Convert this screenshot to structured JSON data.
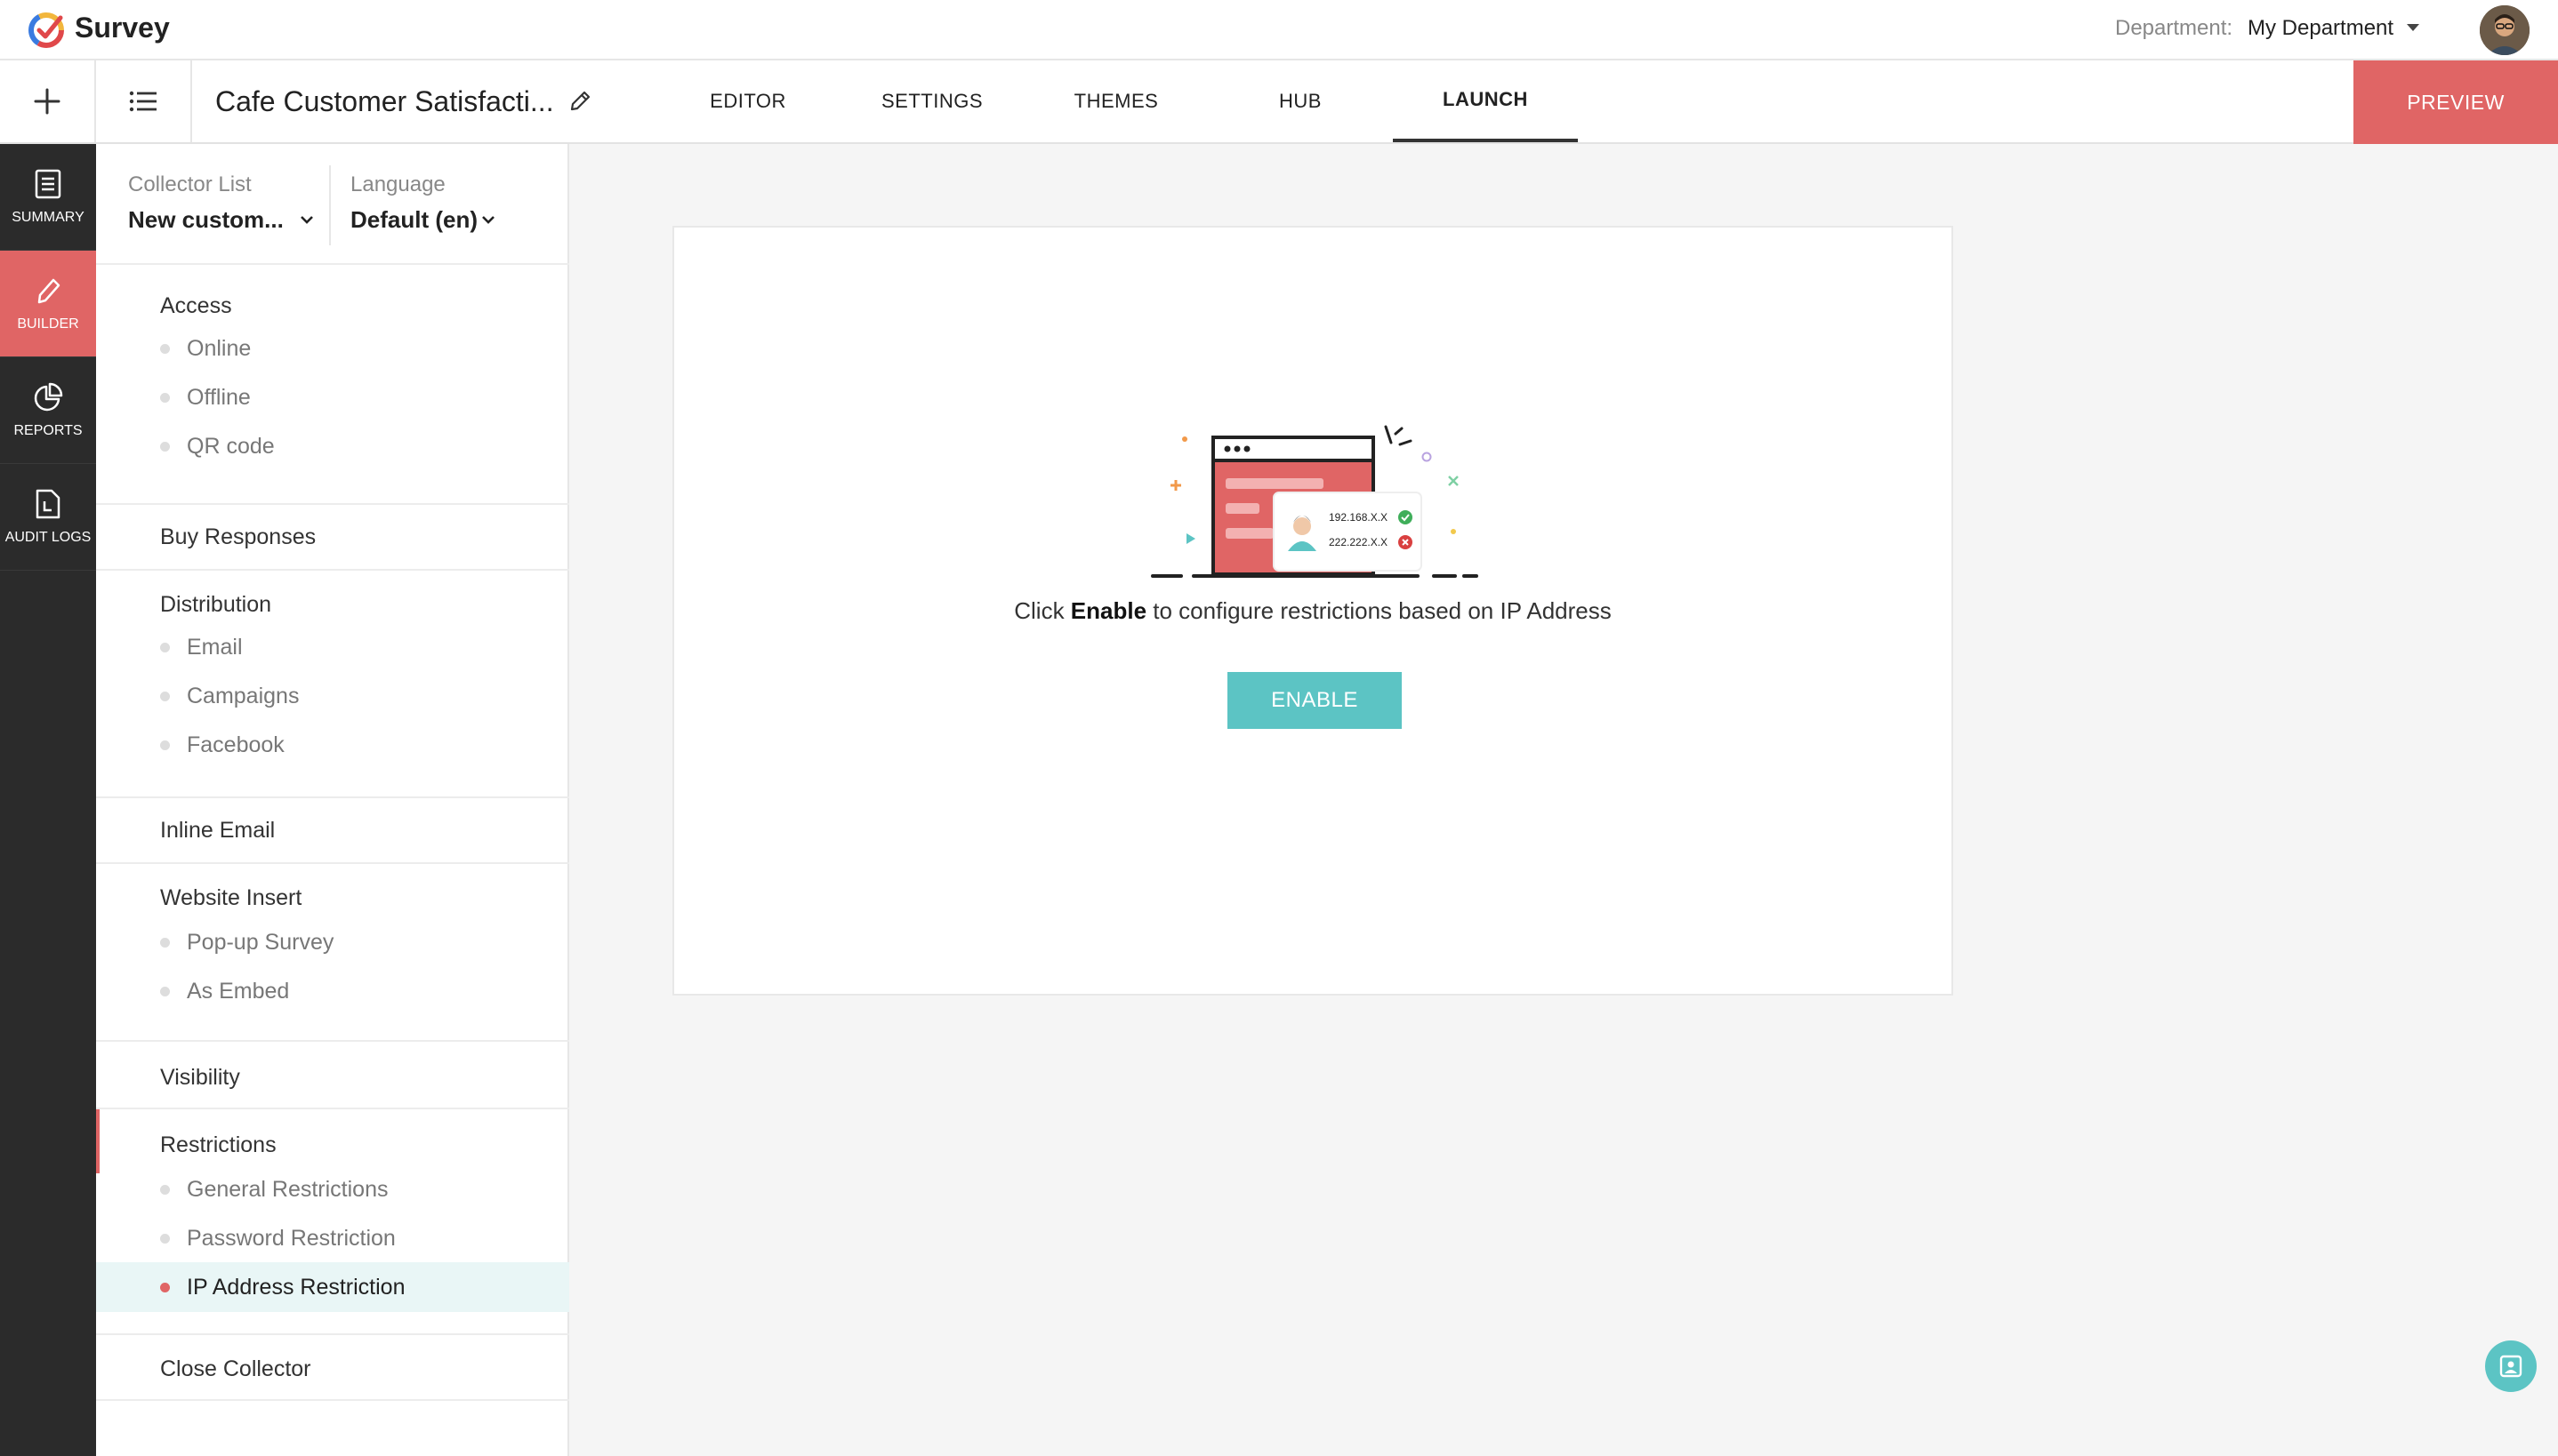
{
  "app": {
    "name": "Survey"
  },
  "header": {
    "department_label": "Department:",
    "department_value": "My Department"
  },
  "toolbar": {
    "survey_title": "Cafe Customer Satisfacti...",
    "tabs": [
      {
        "label": "EDITOR"
      },
      {
        "label": "SETTINGS"
      },
      {
        "label": "THEMES"
      },
      {
        "label": "HUB"
      },
      {
        "label": "LAUNCH",
        "active": true
      }
    ],
    "preview_label": "PREVIEW"
  },
  "rail": {
    "items": [
      {
        "label": "SUMMARY",
        "icon": "document-icon"
      },
      {
        "label": "BUILDER",
        "icon": "pencil-icon",
        "active": true
      },
      {
        "label": "REPORTS",
        "icon": "pie-chart-icon"
      },
      {
        "label": "AUDIT LOGS",
        "icon": "log-file-icon"
      }
    ]
  },
  "collector": {
    "list_label": "Collector List",
    "list_value": "New custom...",
    "language_label": "Language",
    "language_value": "Default (en)"
  },
  "nav": {
    "access": {
      "title": "Access",
      "items": [
        "Online",
        "Offline",
        "QR code"
      ]
    },
    "buy_responses": {
      "title": "Buy Responses"
    },
    "distribution": {
      "title": "Distribution",
      "items": [
        "Email",
        "Campaigns",
        "Facebook"
      ]
    },
    "inline_email": {
      "title": "Inline Email"
    },
    "website_insert": {
      "title": "Website Insert",
      "items": [
        "Pop-up Survey",
        "As Embed"
      ]
    },
    "visibility": {
      "title": "Visibility"
    },
    "restrictions": {
      "title": "Restrictions",
      "items": [
        "General Restrictions",
        "Password Restriction",
        "IP Address Restriction"
      ],
      "active_index": 2
    },
    "close_collector": {
      "title": "Close Collector"
    }
  },
  "main": {
    "illustration": {
      "ip_allowed": "192.168.X.X",
      "ip_blocked": "222.222.X.X"
    },
    "description_prefix": "Click ",
    "description_bold": "Enable",
    "description_suffix": " to configure restrictions based on IP Address",
    "enable_label": "ENABLE"
  },
  "colors": {
    "accent": "#e06565",
    "teal": "#5cc4c4",
    "rail_bg": "#2b2b2b"
  }
}
